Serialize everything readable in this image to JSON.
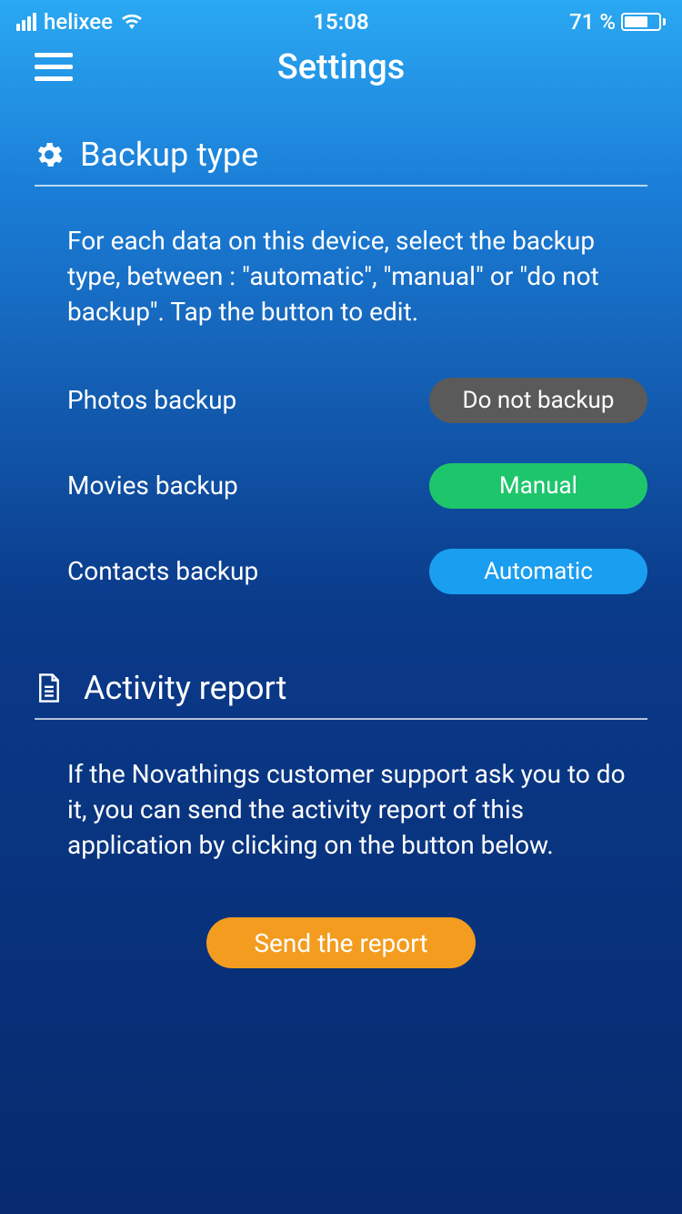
{
  "statusBar": {
    "carrier": "helixee",
    "time": "15:08",
    "battery": "71 %"
  },
  "header": {
    "title": "Settings"
  },
  "backupSection": {
    "title": "Backup type",
    "description": "For each data on this device, select the backup type, between : \"automatic\", \"manual\" or \"do not backup\". Tap the button to edit.",
    "options": [
      {
        "label": "Photos backup",
        "value": "Do not backup",
        "style": "gray"
      },
      {
        "label": "Movies backup",
        "value": "Manual",
        "style": "green"
      },
      {
        "label": "Contacts backup",
        "value": "Automatic",
        "style": "blue"
      }
    ]
  },
  "activitySection": {
    "title": "Activity report",
    "description": "If the Novathings customer support ask you to do it, you can send the activity report of this application by clicking on the button below.",
    "buttonLabel": "Send the report"
  }
}
